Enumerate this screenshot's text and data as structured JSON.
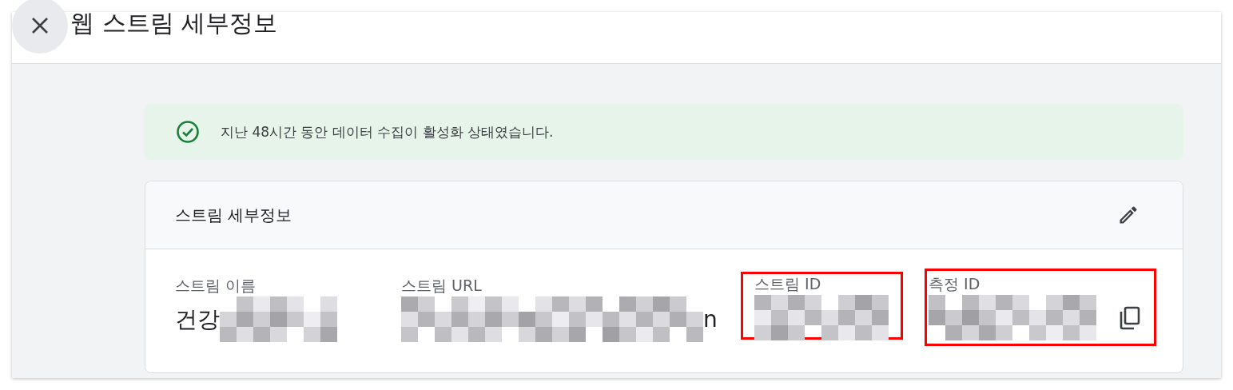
{
  "header": {
    "title": "웹 스트림 세부정보"
  },
  "banner": {
    "message": "지난 48시간 동안 데이터 수집이 활성화 상태였습니다."
  },
  "card": {
    "title": "스트림 세부정보",
    "fields": [
      {
        "label": "스트림 이름",
        "value_start": "건강",
        "highlighted": false,
        "copyable": false
      },
      {
        "label": "스트림 URL",
        "value_end": "n",
        "highlighted": false,
        "copyable": false
      },
      {
        "label": "스트림 ID",
        "highlighted": true,
        "copyable": false
      },
      {
        "label": "측정 ID",
        "highlighted": true,
        "copyable": true
      }
    ]
  }
}
